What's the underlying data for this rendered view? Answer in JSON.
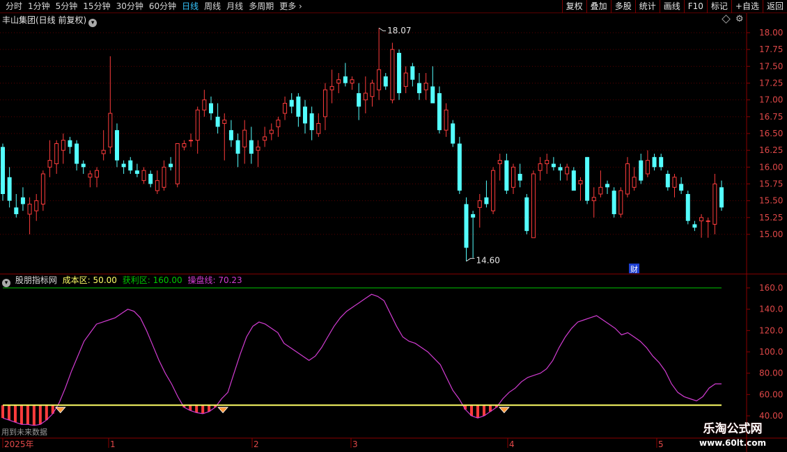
{
  "toolbar": {
    "period_tabs": [
      {
        "label": "分时",
        "active": false
      },
      {
        "label": "1分钟",
        "active": false
      },
      {
        "label": "5分钟",
        "active": false
      },
      {
        "label": "15分钟",
        "active": false
      },
      {
        "label": "30分钟",
        "active": false
      },
      {
        "label": "60分钟",
        "active": false
      },
      {
        "label": "日线",
        "active": true
      },
      {
        "label": "周线",
        "active": false
      },
      {
        "label": "月线",
        "active": false
      },
      {
        "label": "多周期",
        "active": false
      },
      {
        "label": "更多",
        "active": false
      }
    ],
    "right_buttons": [
      "复权",
      "叠加",
      "多股",
      "统计",
      "画线",
      "F10",
      "标记",
      "+自选",
      "返回"
    ]
  },
  "main_panel": {
    "title": "丰山集团(日线 前复权)",
    "dropdown_icon": "chevron-down-icon",
    "high_label": "18.07",
    "low_label": "14.60",
    "finance_marker": "财",
    "y_ticks": [
      "18.00",
      "17.75",
      "17.50",
      "17.25",
      "17.00",
      "16.75",
      "16.50",
      "16.25",
      "16.00",
      "15.75",
      "15.50",
      "15.25",
      "15.00"
    ]
  },
  "indicator_panel": {
    "name": "股朋指标网",
    "cost_label": "成本区:",
    "cost_value": "50.00",
    "profit_label": "获利区:",
    "profit_value": "160.00",
    "op_label": "操盘线:",
    "op_value": "70.23",
    "y_ticks": [
      "160.0",
      "140.0",
      "120.0",
      "100.0",
      "80.00",
      "60.00",
      "40.00"
    ]
  },
  "time_axis": {
    "labels": [
      "2025年",
      "1",
      "2",
      "3",
      "4",
      "5"
    ]
  },
  "status": {
    "text": "用到未来数据"
  },
  "watermark": {
    "title": "乐淘公式网",
    "url": "www.60lt.com"
  },
  "colors": {
    "up": "#ff3c3c",
    "down": "#54ffff",
    "grid": "#5a0000",
    "op_line": "#d23cd2",
    "cost_line": "#ffff66",
    "profit_line": "#00c800",
    "cost_text": "#ffff66",
    "profit_text": "#00c800",
    "op_text": "#d23cd2"
  },
  "chart_data": [
    {
      "type": "candlestick",
      "title": "丰山集团(日线 前复权)",
      "ylim": [
        14.6,
        18.2
      ],
      "annotations": [
        {
          "label": "18.07",
          "value": 18.07
        },
        {
          "label": "14.60",
          "value": 14.6
        }
      ],
      "candles": [
        {
          "o": 16.3,
          "h": 16.35,
          "l": 15.5,
          "c": 15.6
        },
        {
          "o": 15.85,
          "h": 16.0,
          "l": 15.4,
          "c": 15.5
        },
        {
          "o": 15.4,
          "h": 15.6,
          "l": 15.25,
          "c": 15.3
        },
        {
          "o": 15.55,
          "h": 15.7,
          "l": 15.35,
          "c": 15.45
        },
        {
          "o": 15.3,
          "h": 15.55,
          "l": 15.0,
          "c": 15.45
        },
        {
          "o": 15.35,
          "h": 15.6,
          "l": 15.2,
          "c": 15.5
        },
        {
          "o": 15.45,
          "h": 15.95,
          "l": 15.35,
          "c": 15.9
        },
        {
          "o": 16.0,
          "h": 16.4,
          "l": 15.85,
          "c": 16.1
        },
        {
          "o": 16.05,
          "h": 16.4,
          "l": 15.9,
          "c": 16.35
        },
        {
          "o": 16.25,
          "h": 16.5,
          "l": 16.05,
          "c": 16.4
        },
        {
          "o": 16.4,
          "h": 16.45,
          "l": 16.2,
          "c": 16.3
        },
        {
          "o": 16.35,
          "h": 16.4,
          "l": 15.95,
          "c": 16.05
        },
        {
          "o": 16.05,
          "h": 16.1,
          "l": 15.9,
          "c": 16.0
        },
        {
          "o": 15.85,
          "h": 15.95,
          "l": 15.7,
          "c": 15.9
        },
        {
          "o": 15.85,
          "h": 16.0,
          "l": 15.7,
          "c": 15.95
        },
        {
          "o": 16.2,
          "h": 16.55,
          "l": 16.1,
          "c": 16.25
        },
        {
          "o": 16.3,
          "h": 17.65,
          "l": 16.2,
          "c": 16.8
        },
        {
          "o": 16.55,
          "h": 16.65,
          "l": 16.0,
          "c": 16.1
        },
        {
          "o": 16.05,
          "h": 16.1,
          "l": 15.9,
          "c": 16.0
        },
        {
          "o": 16.1,
          "h": 16.15,
          "l": 15.9,
          "c": 15.95
        },
        {
          "o": 15.95,
          "h": 16.05,
          "l": 15.85,
          "c": 15.9
        },
        {
          "o": 15.8,
          "h": 16.0,
          "l": 15.75,
          "c": 15.95
        },
        {
          "o": 15.9,
          "h": 15.95,
          "l": 15.7,
          "c": 15.75
        },
        {
          "o": 15.65,
          "h": 15.95,
          "l": 15.6,
          "c": 15.8
        },
        {
          "o": 15.7,
          "h": 16.1,
          "l": 15.65,
          "c": 16.0
        },
        {
          "o": 16.05,
          "h": 16.15,
          "l": 15.95,
          "c": 16.0
        },
        {
          "o": 15.75,
          "h": 16.35,
          "l": 15.7,
          "c": 16.35
        },
        {
          "o": 16.3,
          "h": 16.4,
          "l": 16.25,
          "c": 16.35
        },
        {
          "o": 16.4,
          "h": 16.5,
          "l": 16.3,
          "c": 16.4
        },
        {
          "o": 16.4,
          "h": 16.9,
          "l": 16.2,
          "c": 16.85
        },
        {
          "o": 16.85,
          "h": 17.15,
          "l": 16.75,
          "c": 17.0
        },
        {
          "o": 16.95,
          "h": 17.05,
          "l": 16.7,
          "c": 16.8
        },
        {
          "o": 16.75,
          "h": 16.95,
          "l": 16.5,
          "c": 16.6
        },
        {
          "o": 16.65,
          "h": 16.8,
          "l": 16.1,
          "c": 16.7
        },
        {
          "o": 16.55,
          "h": 16.7,
          "l": 16.3,
          "c": 16.4
        },
        {
          "o": 16.4,
          "h": 16.5,
          "l": 16.0,
          "c": 16.2
        },
        {
          "o": 16.3,
          "h": 16.7,
          "l": 16.05,
          "c": 16.55
        },
        {
          "o": 16.4,
          "h": 16.6,
          "l": 16.05,
          "c": 16.2
        },
        {
          "o": 16.25,
          "h": 16.4,
          "l": 16.0,
          "c": 16.3
        },
        {
          "o": 16.4,
          "h": 16.6,
          "l": 16.3,
          "c": 16.45
        },
        {
          "o": 16.5,
          "h": 16.65,
          "l": 16.4,
          "c": 16.55
        },
        {
          "o": 16.6,
          "h": 16.75,
          "l": 16.45,
          "c": 16.7
        },
        {
          "o": 16.8,
          "h": 17.05,
          "l": 16.7,
          "c": 16.95
        },
        {
          "o": 17.0,
          "h": 17.1,
          "l": 16.8,
          "c": 16.9
        },
        {
          "o": 17.05,
          "h": 17.1,
          "l": 16.6,
          "c": 16.75
        },
        {
          "o": 16.9,
          "h": 17.0,
          "l": 16.5,
          "c": 16.65
        },
        {
          "o": 16.8,
          "h": 16.9,
          "l": 16.4,
          "c": 16.55
        },
        {
          "o": 16.5,
          "h": 16.8,
          "l": 16.45,
          "c": 16.65
        },
        {
          "o": 16.75,
          "h": 17.25,
          "l": 16.55,
          "c": 17.15
        },
        {
          "o": 17.15,
          "h": 17.45,
          "l": 16.95,
          "c": 17.2
        },
        {
          "o": 17.25,
          "h": 17.4,
          "l": 17.1,
          "c": 17.3
        },
        {
          "o": 17.35,
          "h": 17.55,
          "l": 17.2,
          "c": 17.25
        },
        {
          "o": 17.25,
          "h": 17.35,
          "l": 17.15,
          "c": 17.3
        },
        {
          "o": 17.1,
          "h": 17.25,
          "l": 16.7,
          "c": 16.9
        },
        {
          "o": 17.0,
          "h": 17.35,
          "l": 16.8,
          "c": 17.1
        },
        {
          "o": 17.05,
          "h": 17.3,
          "l": 16.9,
          "c": 17.25
        },
        {
          "o": 17.15,
          "h": 18.07,
          "l": 17.0,
          "c": 17.45
        },
        {
          "o": 17.35,
          "h": 17.4,
          "l": 17.15,
          "c": 17.2
        },
        {
          "o": 17.0,
          "h": 17.85,
          "l": 16.95,
          "c": 17.75
        },
        {
          "o": 17.7,
          "h": 17.75,
          "l": 17.0,
          "c": 17.1
        },
        {
          "o": 17.2,
          "h": 17.5,
          "l": 17.1,
          "c": 17.4
        },
        {
          "o": 17.5,
          "h": 17.55,
          "l": 17.2,
          "c": 17.3
        },
        {
          "o": 17.25,
          "h": 17.4,
          "l": 17.0,
          "c": 17.1
        },
        {
          "o": 17.15,
          "h": 17.4,
          "l": 17.0,
          "c": 17.25
        },
        {
          "o": 17.2,
          "h": 17.5,
          "l": 17.0,
          "c": 16.95
        },
        {
          "o": 17.1,
          "h": 17.2,
          "l": 16.5,
          "c": 16.55
        },
        {
          "o": 16.55,
          "h": 16.95,
          "l": 16.45,
          "c": 16.85
        },
        {
          "o": 16.65,
          "h": 16.7,
          "l": 16.3,
          "c": 16.35
        },
        {
          "o": 16.35,
          "h": 16.45,
          "l": 15.6,
          "c": 15.65
        },
        {
          "o": 15.45,
          "h": 15.55,
          "l": 14.6,
          "c": 14.8
        },
        {
          "o": 15.3,
          "h": 15.35,
          "l": 14.65,
          "c": 15.25
        },
        {
          "o": 15.4,
          "h": 15.6,
          "l": 15.1,
          "c": 15.5
        },
        {
          "o": 15.55,
          "h": 15.8,
          "l": 15.4,
          "c": 15.45
        },
        {
          "o": 15.35,
          "h": 16.0,
          "l": 15.3,
          "c": 15.95
        },
        {
          "o": 16.05,
          "h": 16.2,
          "l": 15.8,
          "c": 16.1
        },
        {
          "o": 16.1,
          "h": 16.2,
          "l": 15.6,
          "c": 15.65
        },
        {
          "o": 15.7,
          "h": 16.05,
          "l": 15.6,
          "c": 16.0
        },
        {
          "o": 15.9,
          "h": 16.05,
          "l": 15.7,
          "c": 15.8
        },
        {
          "o": 15.55,
          "h": 15.6,
          "l": 15.0,
          "c": 15.05
        },
        {
          "o": 14.95,
          "h": 15.95,
          "l": 14.95,
          "c": 15.9
        },
        {
          "o": 15.95,
          "h": 16.15,
          "l": 15.8,
          "c": 16.05
        },
        {
          "o": 16.05,
          "h": 16.2,
          "l": 15.9,
          "c": 16.1
        },
        {
          "o": 16.05,
          "h": 16.15,
          "l": 15.95,
          "c": 16.0
        },
        {
          "o": 16.0,
          "h": 16.05,
          "l": 15.8,
          "c": 15.95
        },
        {
          "o": 15.9,
          "h": 16.05,
          "l": 15.8,
          "c": 16.0
        },
        {
          "o": 15.95,
          "h": 16.0,
          "l": 15.7,
          "c": 15.65
        },
        {
          "o": 15.75,
          "h": 15.85,
          "l": 15.5,
          "c": 15.8
        },
        {
          "o": 16.15,
          "h": 16.15,
          "l": 15.45,
          "c": 15.5
        },
        {
          "o": 15.5,
          "h": 15.7,
          "l": 15.25,
          "c": 15.55
        },
        {
          "o": 15.6,
          "h": 15.95,
          "l": 15.55,
          "c": 15.7
        },
        {
          "o": 15.75,
          "h": 15.8,
          "l": 15.6,
          "c": 15.7
        },
        {
          "o": 15.65,
          "h": 15.7,
          "l": 15.25,
          "c": 15.3
        },
        {
          "o": 15.3,
          "h": 15.7,
          "l": 15.25,
          "c": 15.65
        },
        {
          "o": 15.6,
          "h": 16.15,
          "l": 15.55,
          "c": 16.05
        },
        {
          "o": 15.7,
          "h": 16.0,
          "l": 15.65,
          "c": 15.85
        },
        {
          "o": 16.1,
          "h": 16.2,
          "l": 15.75,
          "c": 15.8
        },
        {
          "o": 15.9,
          "h": 16.25,
          "l": 15.85,
          "c": 16.1
        },
        {
          "o": 16.15,
          "h": 16.2,
          "l": 15.95,
          "c": 16.0
        },
        {
          "o": 16.15,
          "h": 16.2,
          "l": 15.95,
          "c": 16.0
        },
        {
          "o": 15.9,
          "h": 15.95,
          "l": 15.65,
          "c": 15.7
        },
        {
          "o": 15.7,
          "h": 15.9,
          "l": 15.55,
          "c": 15.85
        },
        {
          "o": 15.75,
          "h": 15.85,
          "l": 15.6,
          "c": 15.65
        },
        {
          "o": 15.6,
          "h": 15.65,
          "l": 15.15,
          "c": 15.2
        },
        {
          "o": 15.15,
          "h": 15.2,
          "l": 15.05,
          "c": 15.1
        },
        {
          "o": 15.2,
          "h": 15.3,
          "l": 14.95,
          "c": 15.25
        },
        {
          "o": 15.2,
          "h": 15.25,
          "l": 14.95,
          "c": 15.2
        },
        {
          "o": 15.15,
          "h": 15.9,
          "l": 15.0,
          "c": 15.75
        },
        {
          "o": 15.7,
          "h": 15.8,
          "l": 15.35,
          "c": 15.4
        }
      ]
    },
    {
      "type": "line",
      "title": "股朋指标网",
      "ylim": [
        35,
        170
      ],
      "series": [
        {
          "name": "成本区",
          "constant": 50.0
        },
        {
          "name": "获利区",
          "constant": 160.0
        },
        {
          "name": "操盘线",
          "values": [
            38,
            36,
            34,
            32,
            32,
            31,
            32,
            36,
            42,
            52,
            66,
            82,
            96,
            110,
            118,
            126,
            128,
            130,
            132,
            136,
            140,
            138,
            132,
            120,
            106,
            92,
            80,
            70,
            58,
            48,
            45,
            43,
            42,
            44,
            48,
            56,
            62,
            80,
            98,
            114,
            124,
            128,
            126,
            122,
            118,
            108,
            104,
            100,
            96,
            92,
            96,
            104,
            114,
            124,
            132,
            138,
            142,
            146,
            150,
            154,
            152,
            148,
            136,
            124,
            114,
            110,
            108,
            104,
            100,
            94,
            88,
            76,
            64,
            56,
            46,
            40,
            38,
            40,
            44,
            48,
            56,
            62,
            66,
            72,
            76,
            78,
            80,
            84,
            92,
            104,
            114,
            122,
            128,
            130,
            132,
            134,
            130,
            126,
            122,
            116,
            118,
            114,
            110,
            104,
            96,
            90,
            82,
            70,
            62,
            58,
            56,
            54,
            58,
            66,
            70,
            70
          ]
        }
      ]
    }
  ]
}
